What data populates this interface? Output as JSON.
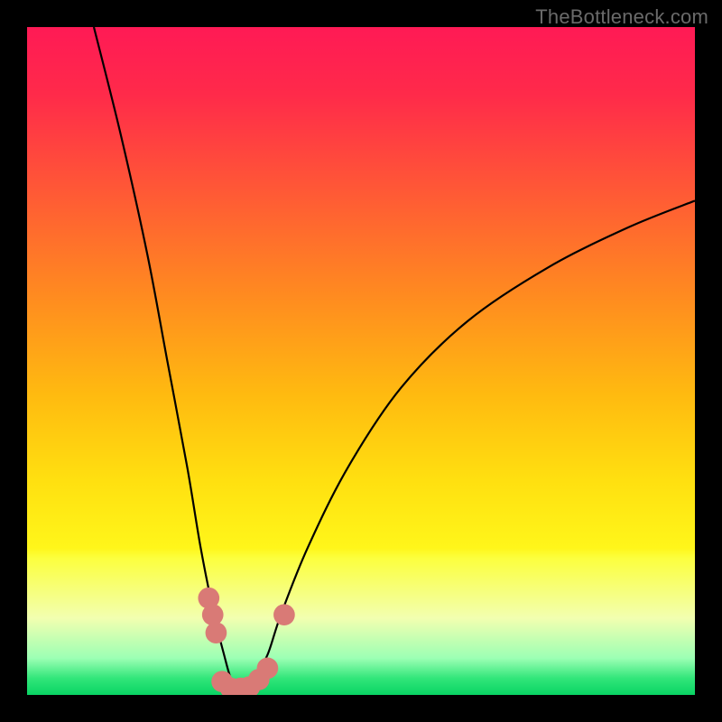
{
  "watermark": "TheBottleneck.com",
  "chart_data": {
    "type": "line",
    "title": "",
    "xlabel": "",
    "ylabel": "",
    "xlim": [
      0,
      100
    ],
    "ylim": [
      0,
      100
    ],
    "grid": false,
    "legend": false,
    "series": [
      {
        "name": "bottleneck-curve",
        "x": [
          10,
          14,
          18,
          21,
          24,
          26,
          28,
          29.5,
          30.5,
          31.5,
          32.5,
          34,
          36,
          38,
          42,
          48,
          56,
          66,
          78,
          90,
          100
        ],
        "y": [
          100,
          84,
          66,
          50,
          34,
          22,
          12,
          6,
          2.5,
          1.2,
          1.2,
          2.5,
          6,
          12,
          22,
          34,
          46,
          56,
          64,
          70,
          74
        ]
      }
    ],
    "markers": [
      {
        "name": "left-outer",
        "x": 27.2,
        "y": 14.5,
        "r": 1.6
      },
      {
        "name": "left-stack-a",
        "x": 27.8,
        "y": 12.0,
        "r": 1.6
      },
      {
        "name": "left-stack-b",
        "x": 28.3,
        "y": 9.3,
        "r": 1.6
      },
      {
        "name": "bottom-a",
        "x": 29.2,
        "y": 2.0,
        "r": 1.6
      },
      {
        "name": "bottom-b",
        "x": 30.5,
        "y": 1.0,
        "r": 1.6
      },
      {
        "name": "bottom-c",
        "x": 32.0,
        "y": 1.0,
        "r": 1.6
      },
      {
        "name": "bottom-d",
        "x": 33.3,
        "y": 1.2,
        "r": 1.6
      },
      {
        "name": "bottom-e",
        "x": 34.7,
        "y": 2.3,
        "r": 1.6
      },
      {
        "name": "bottom-f",
        "x": 36.0,
        "y": 4.0,
        "r": 1.6
      },
      {
        "name": "right-outer",
        "x": 38.5,
        "y": 12.0,
        "r": 1.6
      }
    ],
    "gradient_stops": [
      {
        "offset": 0.0,
        "color": "#ff1a55"
      },
      {
        "offset": 0.1,
        "color": "#ff2a4a"
      },
      {
        "offset": 0.25,
        "color": "#ff5a35"
      },
      {
        "offset": 0.4,
        "color": "#ff8a20"
      },
      {
        "offset": 0.55,
        "color": "#ffba10"
      },
      {
        "offset": 0.68,
        "color": "#ffe010"
      },
      {
        "offset": 0.78,
        "color": "#fff61a"
      },
      {
        "offset": 0.795,
        "color": "#fcff3e"
      },
      {
        "offset": 0.885,
        "color": "#f2ffb0"
      },
      {
        "offset": 0.945,
        "color": "#9cffb4"
      },
      {
        "offset": 0.975,
        "color": "#32e67a"
      },
      {
        "offset": 1.0,
        "color": "#09d463"
      }
    ],
    "marker_color": "#d97a76",
    "curve_color": "#000000"
  }
}
